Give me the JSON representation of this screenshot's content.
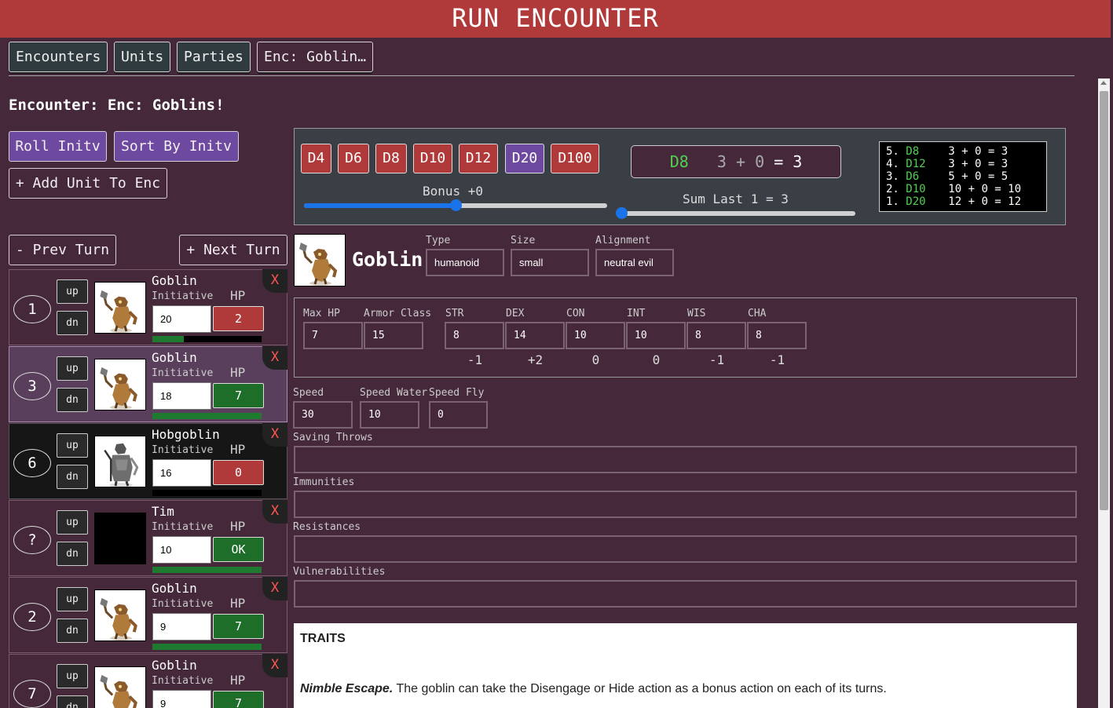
{
  "header": {
    "title": "RUN ENCOUNTER"
  },
  "tabs": [
    "Encounters",
    "Units",
    "Parties",
    "Enc: Goblin…"
  ],
  "encounter_title": "Encounter: Enc: Goblins!",
  "buttons": {
    "roll": "Roll Initv",
    "sort": "Sort By Initv",
    "add_unit": "+ Add Unit To Enc",
    "prev": "- Prev Turn",
    "next": "+ Next Turn"
  },
  "combatants": [
    {
      "order": "1",
      "name": "Goblin",
      "initiative": "20",
      "hp": "2",
      "hp_status": "red",
      "hp_fraction": 0.29,
      "state": "normal"
    },
    {
      "order": "3",
      "name": "Goblin",
      "initiative": "18",
      "hp": "7",
      "hp_status": "green",
      "hp_fraction": 1.0,
      "state": "current"
    },
    {
      "order": "6",
      "name": "Hobgoblin",
      "initiative": "16",
      "hp": "0",
      "hp_status": "red",
      "hp_fraction": 0.0,
      "state": "dead"
    },
    {
      "order": "?",
      "name": "Tim",
      "initiative": "10",
      "hp": "OK",
      "hp_status": "green",
      "hp_fraction": 1.0,
      "state": "normal"
    },
    {
      "order": "2",
      "name": "Goblin",
      "initiative": "9",
      "hp": "7",
      "hp_status": "green",
      "hp_fraction": 1.0,
      "state": "normal"
    },
    {
      "order": "7",
      "name": "Goblin",
      "initiative": "9",
      "hp": "7",
      "hp_status": "green",
      "hp_fraction": 1.0,
      "state": "normal"
    }
  ],
  "row_labels": {
    "up": "up",
    "dn": "dn",
    "initiative": "Initiative",
    "hp": "HP",
    "close": "X"
  },
  "dice": {
    "buttons": [
      "D4",
      "D6",
      "D8",
      "D10",
      "D12",
      "D20",
      "D100"
    ],
    "selected": "D20",
    "bonus_label": "Bonus +0",
    "bonus_fraction": 0.5,
    "last_roll": {
      "die": "D8",
      "expr": "3 + 0",
      "total": "= 3"
    },
    "sum_label": "Sum Last 1 = 3",
    "sum_fraction": 0.0,
    "history": [
      {
        "n": "5.",
        "die": "D8",
        "expr": "3 + 0 = 3"
      },
      {
        "n": "4.",
        "die": "D12",
        "expr": "3 + 0 = 3"
      },
      {
        "n": "3.",
        "die": "D6",
        "expr": "5 + 0 = 5"
      },
      {
        "n": "2.",
        "die": "D10",
        "expr": "10 + 0 = 10"
      },
      {
        "n": "1.",
        "die": "D20",
        "expr": "12 + 0 = 12"
      }
    ]
  },
  "monster": {
    "name": "Goblin",
    "type_label": "Type",
    "type": "humanoid",
    "size_label": "Size",
    "size": "small",
    "alignment_label": "Alignment",
    "alignment": "neutral evil",
    "max_hp_label": "Max HP",
    "max_hp": "7",
    "ac_label": "Armor Class",
    "ac": "15",
    "abilities": [
      {
        "label": "STR",
        "value": "8",
        "mod": "-1"
      },
      {
        "label": "DEX",
        "value": "14",
        "mod": "+2"
      },
      {
        "label": "CON",
        "value": "10",
        "mod": "0"
      },
      {
        "label": "INT",
        "value": "10",
        "mod": "0"
      },
      {
        "label": "WIS",
        "value": "8",
        "mod": "-1"
      },
      {
        "label": "CHA",
        "value": "8",
        "mod": "-1"
      }
    ],
    "speed_label": "Speed",
    "speed": "30",
    "speed_water_label": "Speed Water",
    "speed_water": "10",
    "speed_fly_label": "Speed Fly",
    "speed_fly": "0",
    "saving_throws_label": "Saving Throws",
    "immunities_label": "Immunities",
    "resistances_label": "Resistances",
    "vulnerabilities_label": "Vulnerabilities",
    "traits_title": "TRAITS",
    "trait_name": "Nimble Escape.",
    "trait_text": " The goblin can take the Disengage or Hide action as a bonus action on each of its turns."
  },
  "colors": {
    "accent_red": "#b03a3a",
    "accent_purple": "#6d4aa0",
    "ok_green": "#1e6e29",
    "bg": "#45293a"
  }
}
